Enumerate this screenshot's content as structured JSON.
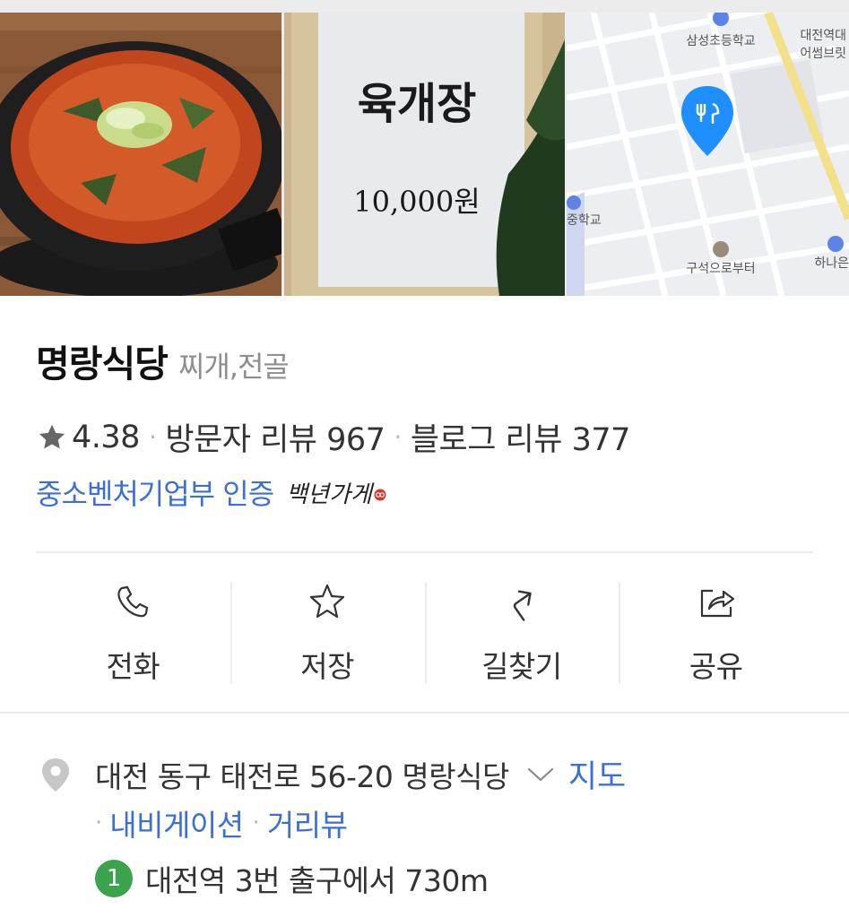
{
  "photos": {
    "menu_item": "육개장",
    "menu_price": "10,000원",
    "map_labels": {
      "school_top": "삼성초등학교",
      "right_top_1": "대전역대",
      "right_top_2": "어썸브릿",
      "school_left": "중학교",
      "bottom_center": "구석으로부터",
      "bottom_right": "하나은"
    }
  },
  "store": {
    "name": "명랑식당",
    "category": "찌개,전골"
  },
  "stats": {
    "rating": "4.38",
    "visitor_reviews": "방문자 리뷰 967",
    "blog_reviews": "블로그 리뷰 377",
    "separator": "·"
  },
  "certification": {
    "link": "중소벤처기업부 인증",
    "badge": "백년가게"
  },
  "actions": [
    {
      "label": "전화",
      "icon": "phone-icon"
    },
    {
      "label": "저장",
      "icon": "star-icon"
    },
    {
      "label": "길찾기",
      "icon": "directions-icon"
    },
    {
      "label": "공유",
      "icon": "share-icon"
    }
  ],
  "address": {
    "text": "대전 동구 태전로 56-20 명랑식당",
    "map_link": "지도",
    "navigation_link": "내비게이션",
    "street_view_link": "거리뷰"
  },
  "transit": {
    "line_number": "1",
    "text": "대전역 3번 출구에서 730m"
  },
  "colors": {
    "link": "#3b6fd6",
    "subway_line_1": "#3aa34b",
    "map_pin": "#1f8fff"
  }
}
